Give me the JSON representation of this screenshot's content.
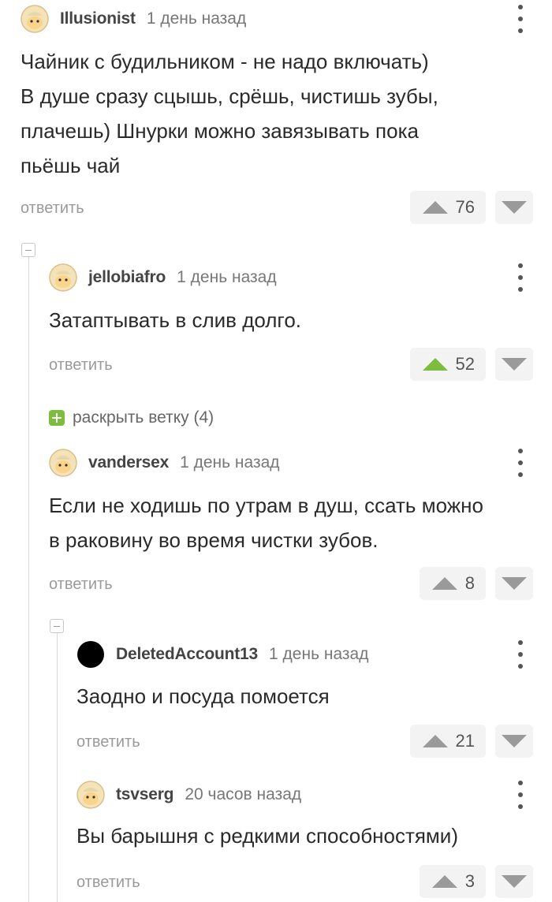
{
  "comments": [
    {
      "author": "Illusionist",
      "time": "1 день назад",
      "text": "Чайник с будильником - не надо включать)\nВ душе сразу сцышь, срёшь, чистишь зубы,\nплачешь) Шнурки можно завязывать пока\nпьёшь чай",
      "reply": "ответить",
      "votes": "76"
    },
    {
      "author": "jellobiafro",
      "time": "1 день назад",
      "text": "Затаптывать в слив долго.",
      "reply": "ответить",
      "votes": "52"
    },
    {
      "author": "vandersex",
      "time": "1 день назад",
      "text": "Если не ходишь по утрам в душ, ссать можно\nв раковину во время чистки зубов.",
      "reply": "ответить",
      "votes": "8"
    },
    {
      "author": "DeletedAccount13",
      "time": "1 день назад",
      "text": "Заодно и посуда помоется",
      "reply": "ответить",
      "votes": "21"
    },
    {
      "author": "tsvserg",
      "time": "20 часов назад",
      "text": "Вы барышня с редкими способностями)",
      "reply": "ответить",
      "votes": "3"
    }
  ],
  "expand_branch": {
    "label": "раскрыть ветку (4)"
  },
  "colors": {
    "upvoted": "#7cbc3f",
    "vote_bg": "#f3f3f3",
    "muted": "#9a9a9a"
  }
}
